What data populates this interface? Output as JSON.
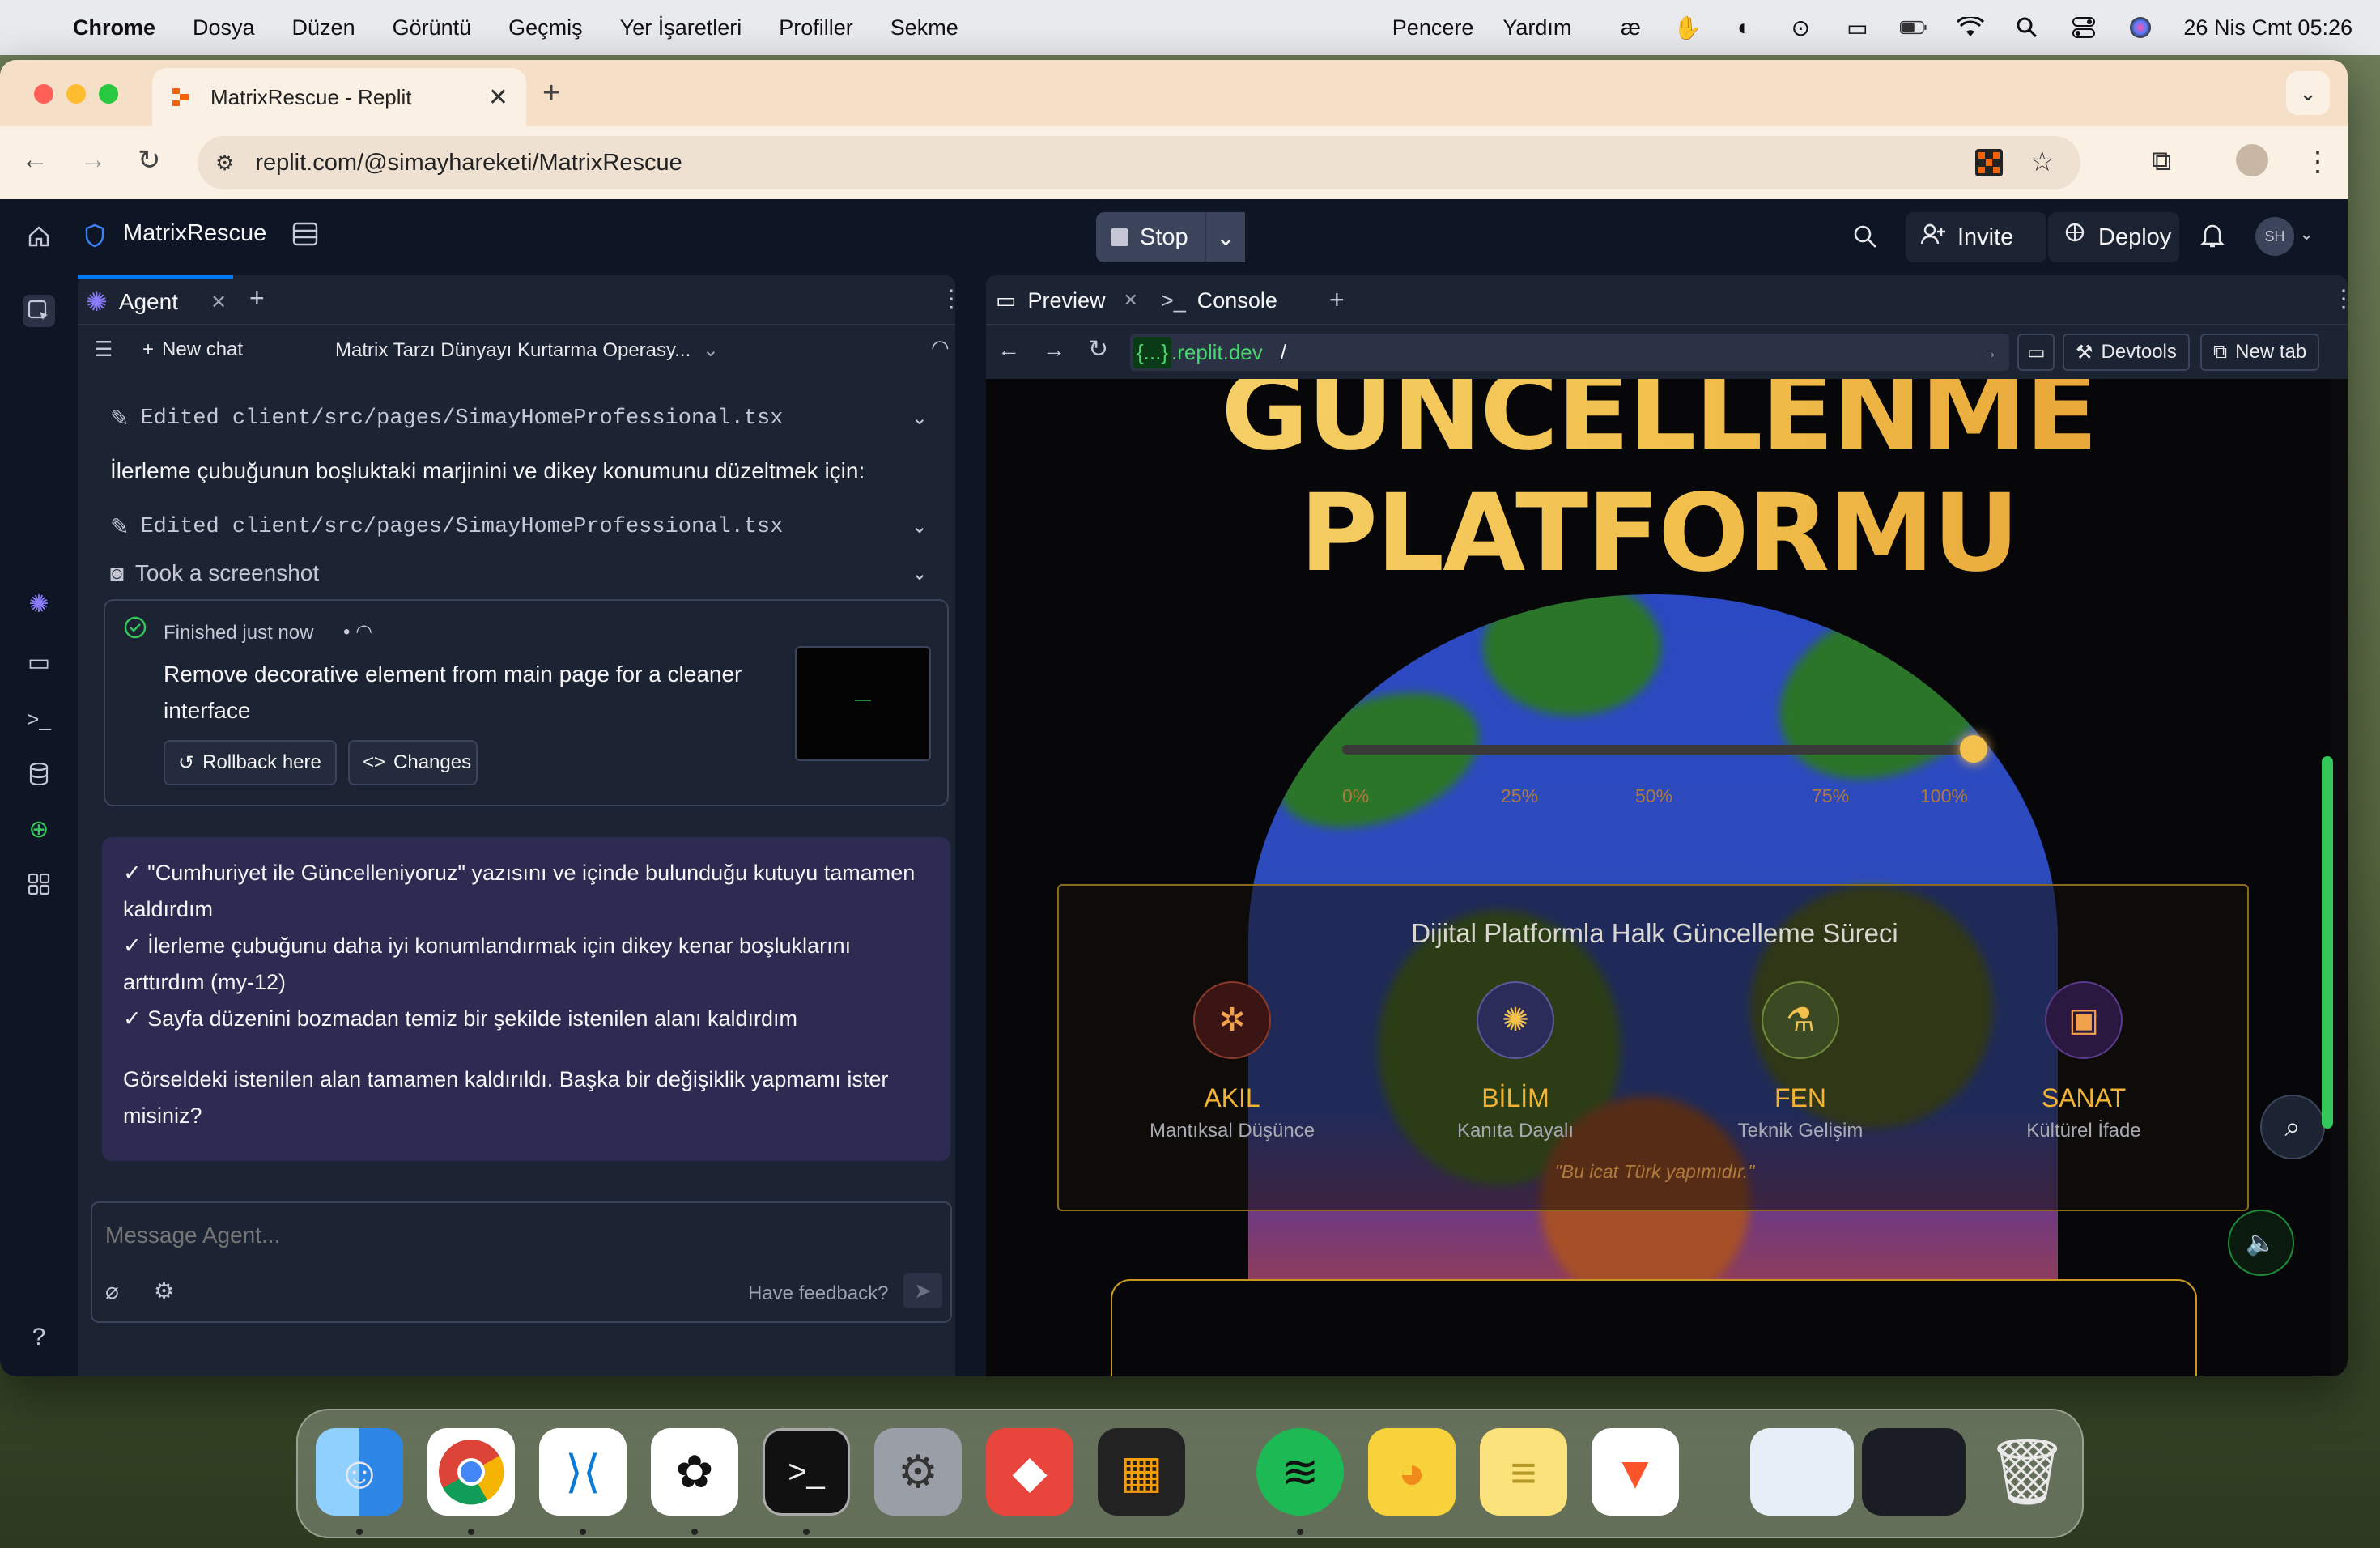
{
  "menubar": {
    "app": "Chrome",
    "items": [
      "Dosya",
      "Düzen",
      "Görüntü",
      "Geçmiş",
      "Yer İşaretleri",
      "Profiller",
      "Sekme"
    ],
    "right_items": [
      "Pencere",
      "Yardım"
    ],
    "datetime": "26 Nis Cmt  05:26"
  },
  "browser": {
    "tab_title": "MatrixRescue - Replit",
    "url": "replit.com/@simayhareketi/MatrixRescue"
  },
  "replit": {
    "project_name": "MatrixRescue",
    "stop_label": "Stop",
    "invite_label": "Invite",
    "deploy_label": "Deploy",
    "avatar_initials": "SH",
    "left_tab": "Agent",
    "new_chat": "New chat",
    "chat_title": "Matrix Tarzı Dünyayı Kurtarma Operasy...",
    "edited_1": "Edited client/src/pages/SimayHomeProfessional.tsx",
    "progress_note": "İlerleme çubuğunun boşluktaki marjinini ve dikey konumunu düzeltmek için:",
    "edited_2": "Edited client/src/pages/SimayHomeProfessional.tsx",
    "took_screenshot": "Took a screenshot",
    "checkpoint": {
      "status": "Finished just now",
      "title": "Remove decorative element from main page for a cleaner interface",
      "rollback": "Rollback here",
      "changes": "Changes"
    },
    "reply_lines": [
      "✓ \"Cumhuriyet ile Güncelleniyoruz\" yazısını ve içinde bulunduğu kutuyu tamamen kaldırdım",
      "✓ İlerleme çubuğunu daha iyi konumlandırmak için dikey kenar boşluklarını arttırdım (my-12)",
      "✓ Sayfa düzenini bozmadan temiz bir şekilde istenilen alanı kaldırdım"
    ],
    "reply_closing": "Görseldeki istenilen alan tamamen kaldırıldı. Başka bir değişiklik yapmamı ister misiniz?",
    "composer_placeholder": "Message Agent...",
    "feedback": "Have feedback?",
    "preview_tab": "Preview",
    "console_tab": "Console",
    "url_host": "{...}",
    "url_host_suffix": ".replit.dev",
    "url_path": "/",
    "devtools": "Devtools",
    "new_tab": "New tab"
  },
  "site": {
    "title_line1": "GÜNCELLENME",
    "title_line2": "PLATFORMU",
    "progress_value_pct": 100,
    "progress_ticks": [
      "0%",
      "25%",
      "50%",
      "75%",
      "100%"
    ],
    "process_heading": "Dijital Platformla Halk Güncelleme Süreci",
    "pillars": [
      {
        "name": "AKIL",
        "sub": "Mantıksal Düşünce",
        "icon": "sparkle-icon"
      },
      {
        "name": "BİLİM",
        "sub": "Kanıta Dayalı",
        "icon": "lightbulb-icon"
      },
      {
        "name": "FEN",
        "sub": "Teknik Gelişim",
        "icon": "flask-icon"
      },
      {
        "name": "SANAT",
        "sub": "Kültürel İfade",
        "icon": "image-icon"
      }
    ],
    "quote": "\"Bu icat Türk yapımıdır.\""
  },
  "colors": {
    "replit_bg": "#0e1525",
    "panel_bg": "#1c2333",
    "reply_bg": "#2d2b52",
    "accent_gold": "#f2c14e",
    "scroll_green": "#34c759"
  }
}
